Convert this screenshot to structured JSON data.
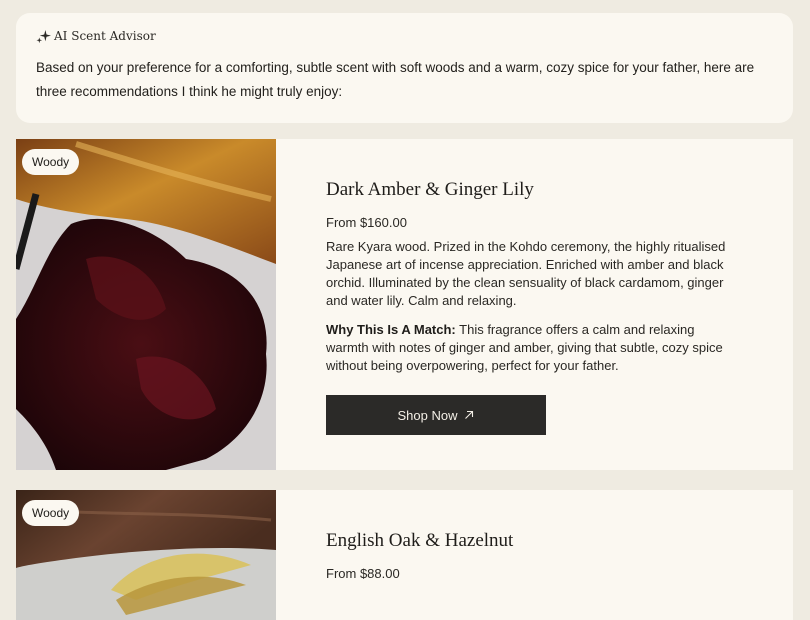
{
  "advisor": {
    "title": "AI Scent Advisor",
    "icon": "sparkle-icon",
    "message": "Based on your preference for a comforting, subtle scent with soft woods and a warm, cozy spice for your father, here are three recommendations I think he might truly enjoy:"
  },
  "products": [
    {
      "tag": "Woody",
      "name": "Dark Amber & Ginger Lily",
      "price": "From $160.00",
      "description": "Rare Kyara wood. Prized in the Kohdo ceremony, the highly ritualised Japanese art of incense appreciation. Enriched with amber and black orchid. Illuminated by the clean sensuality of black cardamom, ginger and water lily. Calm and relaxing.",
      "match_label": "Why This Is A Match:",
      "match_text": " This fragrance offers a calm and relaxing warmth with notes of ginger and amber, giving that subtle, cozy spice without being overpowering, perfect for your father.",
      "cta": "Shop Now",
      "cta_icon": "arrow-up-right-icon"
    },
    {
      "tag": "Woody",
      "name": "English Oak & Hazelnut",
      "price": "From $88.00"
    }
  ],
  "colors": {
    "page_bg": "#efebe1",
    "card_bg": "#fbf8f1",
    "button_bg": "#2b2a28"
  }
}
